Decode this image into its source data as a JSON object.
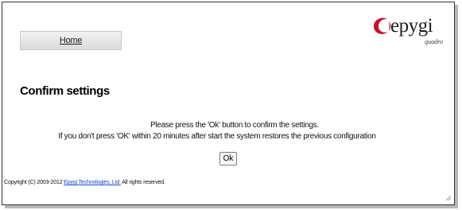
{
  "nav": {
    "home_label": "Home"
  },
  "logo": {
    "brand": "epygi",
    "product": "quadro",
    "mark_color": "#c8102e"
  },
  "page": {
    "title": "Confirm settings",
    "message_line1": "Please press the 'Ok' button to confirm the settings.",
    "message_line2": "If you don't press 'OK' within 20 minutes after start the system restores the previous configuration",
    "ok_label": "Ok"
  },
  "footer": {
    "prefix": "Copyright (C) 2003-2012 ",
    "company_link": "Epygi Technologies, Ltd.",
    "suffix": " All rights reserved."
  }
}
